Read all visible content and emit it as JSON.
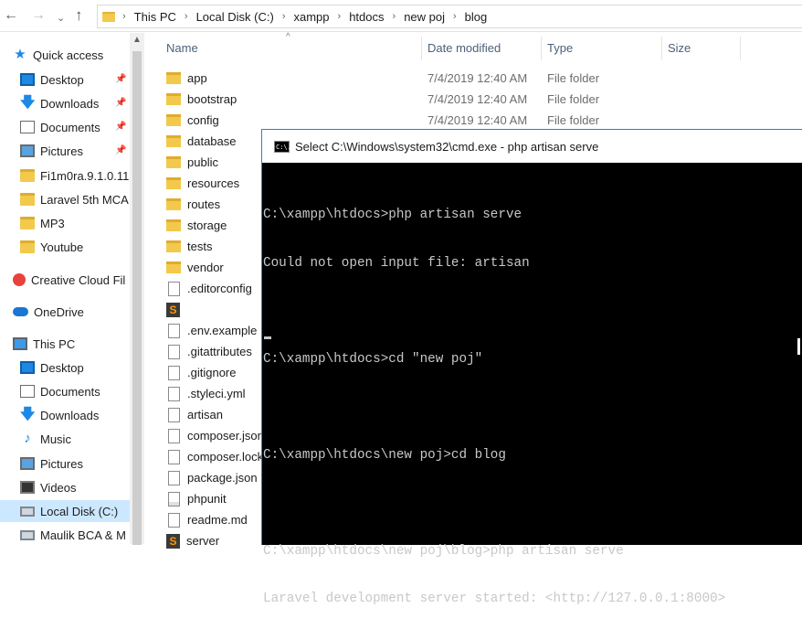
{
  "address_bar": {
    "crumbs": [
      "This PC",
      "Local Disk (C:)",
      "xampp",
      "htdocs",
      "new poj",
      "blog"
    ]
  },
  "nav_pane": {
    "items": [
      {
        "label": "Quick access",
        "icon": "star-icon",
        "pinned": false
      },
      {
        "label": "Desktop",
        "icon": "desktop-icon",
        "pinned": true
      },
      {
        "label": "Downloads",
        "icon": "download-icon",
        "pinned": true
      },
      {
        "label": "Documents",
        "icon": "documents-icon",
        "pinned": true
      },
      {
        "label": "Pictures",
        "icon": "pictures-icon",
        "pinned": true
      },
      {
        "label": "Fi1m0ra.9.1.0.11|",
        "icon": "folder-icon",
        "pinned": false
      },
      {
        "label": "Laravel 5th MCA",
        "icon": "folder-icon",
        "pinned": false
      },
      {
        "label": "MP3",
        "icon": "folder-icon",
        "pinned": false
      },
      {
        "label": "Youtube",
        "icon": "folder-icon",
        "pinned": false
      },
      {
        "label": "Creative Cloud Fil",
        "icon": "creative-cloud-icon",
        "pinned": false
      },
      {
        "label": "OneDrive",
        "icon": "onedrive-icon",
        "pinned": false
      },
      {
        "label": "This PC",
        "icon": "pc-icon",
        "pinned": false
      },
      {
        "label": "Desktop",
        "icon": "desktop-icon",
        "pinned": false
      },
      {
        "label": "Documents",
        "icon": "documents-icon",
        "pinned": false
      },
      {
        "label": "Downloads",
        "icon": "download-icon",
        "pinned": false
      },
      {
        "label": "Music",
        "icon": "music-icon",
        "pinned": false
      },
      {
        "label": "Pictures",
        "icon": "pictures-icon",
        "pinned": false
      },
      {
        "label": "Videos",
        "icon": "videos-icon",
        "pinned": false
      },
      {
        "label": "Local Disk (C:)",
        "icon": "drive-icon",
        "pinned": false,
        "selected": true
      },
      {
        "label": "Maulik BCA & M",
        "icon": "drive-icon",
        "pinned": false
      }
    ]
  },
  "file_list": {
    "columns": {
      "name": "Name",
      "date": "Date modified",
      "type": "Type",
      "size": "Size"
    },
    "rows": [
      {
        "name": "app",
        "kind": "folder",
        "date": "7/4/2019 12:40 AM",
        "type": "File folder"
      },
      {
        "name": "bootstrap",
        "kind": "folder",
        "date": "7/4/2019 12:40 AM",
        "type": "File folder"
      },
      {
        "name": "config",
        "kind": "folder",
        "date": "7/4/2019 12:40 AM",
        "type": "File folder"
      },
      {
        "name": "database",
        "kind": "folder",
        "date": "",
        "type": ""
      },
      {
        "name": "public",
        "kind": "folder",
        "date": "",
        "type": ""
      },
      {
        "name": "resources",
        "kind": "folder",
        "date": "",
        "type": ""
      },
      {
        "name": "routes",
        "kind": "folder",
        "date": "",
        "type": ""
      },
      {
        "name": "storage",
        "kind": "folder",
        "date": "",
        "type": ""
      },
      {
        "name": "tests",
        "kind": "folder",
        "date": "",
        "type": ""
      },
      {
        "name": "vendor",
        "kind": "folder",
        "date": "",
        "type": ""
      },
      {
        "name": ".editorconfig",
        "kind": "file",
        "date": "",
        "type": ""
      },
      {
        "name": "",
        "kind": "sublime",
        "date": "",
        "type": ""
      },
      {
        "name": ".env.example",
        "kind": "file",
        "date": "",
        "type": ""
      },
      {
        "name": ".gitattributes",
        "kind": "file",
        "date": "",
        "type": ""
      },
      {
        "name": ".gitignore",
        "kind": "file",
        "date": "",
        "type": ""
      },
      {
        "name": ".styleci.yml",
        "kind": "file",
        "date": "",
        "type": ""
      },
      {
        "name": "artisan",
        "kind": "file",
        "date": "",
        "type": ""
      },
      {
        "name": "composer.json",
        "kind": "file",
        "date": "",
        "type": ""
      },
      {
        "name": "composer.lock",
        "kind": "file",
        "date": "",
        "type": ""
      },
      {
        "name": "package.json",
        "kind": "file",
        "date": "",
        "type": ""
      },
      {
        "name": "phpunit",
        "kind": "xml",
        "date": "",
        "type": ""
      },
      {
        "name": "readme.md",
        "kind": "file",
        "date": "",
        "type": ""
      },
      {
        "name": "server",
        "kind": "sublime",
        "date": "",
        "type": ""
      }
    ]
  },
  "cmd": {
    "title": "Select C:\\Windows\\system32\\cmd.exe - php  artisan serve",
    "icon_text": "C:\\.",
    "lines": [
      "C:\\xampp\\htdocs>php artisan serve",
      "Could not open input file: artisan",
      "",
      "C:\\xampp\\htdocs>cd \"new poj\"",
      "",
      "C:\\xampp\\htdocs\\new poj>cd blog",
      "",
      "C:\\xampp\\htdocs\\new poj\\blog>php artisan serve",
      "Laravel development server started: <http://127.0.0.1:8000>"
    ]
  }
}
